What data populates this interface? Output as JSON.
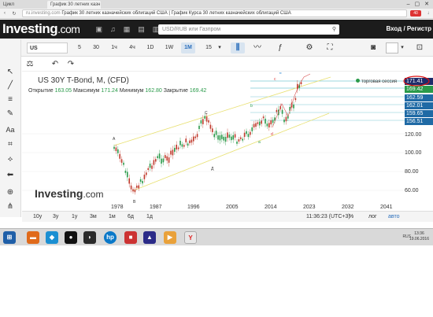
{
  "browser": {
    "tabs": [
      "Цикл",
      "График 30 летних казн"
    ],
    "address_domain": "ru.investing.com",
    "address_title": "График 30 летних казначейских облигаций США | График Курса 30 летних казначейских облигаций США",
    "badge": "40"
  },
  "header": {
    "logo": "Investing",
    "logo_suffix": ".com",
    "search_placeholder": "USD/RUB или Газпром",
    "login_label": "Вход / Регистр"
  },
  "toolbar": {
    "symbol": "US",
    "intervals": [
      "5",
      "30",
      "1ч",
      "4ч",
      "1D",
      "1W",
      "1M",
      "15"
    ],
    "active_interval": "1M"
  },
  "chart": {
    "title": "US 30Y T-Bond, M, (CFD)",
    "open_label": "Открытие",
    "open": "163.05",
    "high_label": "Максимум",
    "high": "171.24",
    "low_label": "Минимум",
    "low": "162.80",
    "close_label": "Закрытие",
    "close": "169.42",
    "session_label": "торговая сессия",
    "watermark": "Investing",
    "watermark_suffix": ".com",
    "price_labels": [
      {
        "value": "171.41",
        "color": "#1e2c6a"
      },
      {
        "value": "169.42",
        "color": "#2a9a4a"
      },
      {
        "value": "162.59",
        "color": "#1f6aa5"
      },
      {
        "value": "162.01",
        "color": "#1f6aa5"
      },
      {
        "value": "159.65",
        "color": "#1f6aa5"
      },
      {
        "value": "156.51",
        "color": "#1f6aa5"
      }
    ],
    "y_axis": [
      "120.00",
      "100.00",
      "80.00",
      "60.00"
    ],
    "x_axis": [
      "1978",
      "1987",
      "1996",
      "2005",
      "2014",
      "2023",
      "2032",
      "2041"
    ],
    "wave_labels": [
      "A",
      "B",
      "C",
      "Д",
      "E",
      "a",
      "b",
      "c",
      "d",
      "e"
    ]
  },
  "periods": [
    "10y",
    "3y",
    "1y",
    "3м",
    "1м",
    "6д",
    "1д"
  ],
  "bottom_right": {
    "time": "11:36:23 (UTC+3)",
    "pct": "%",
    "log": "лог",
    "auto": "авто"
  },
  "taskbar": {
    "lang": "RUS",
    "time": "13:36",
    "date": "19.06.2016"
  },
  "colors": {
    "header_bg": "#1c1c1c",
    "accent": "#2a6ebb",
    "candle_up": "#2a9a4a",
    "candle_down": "#c0392b",
    "channel": "#e8e070"
  }
}
